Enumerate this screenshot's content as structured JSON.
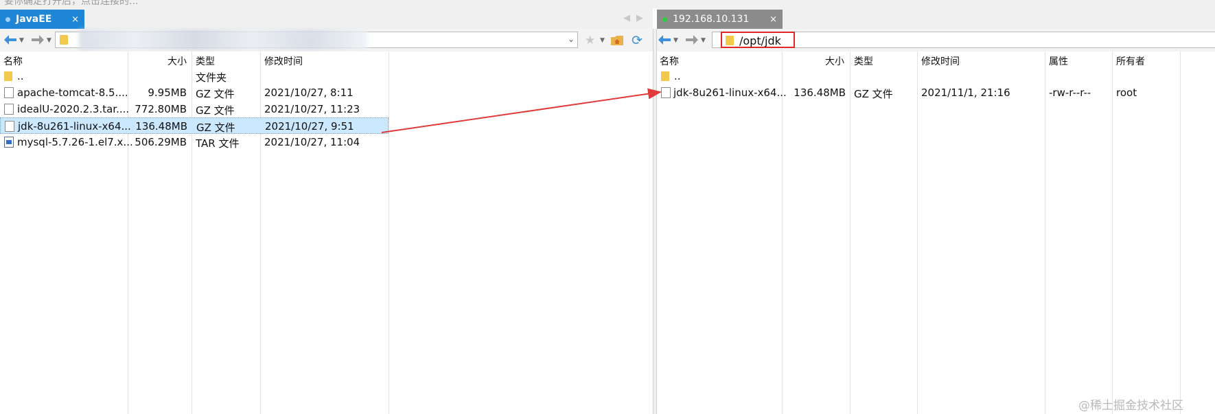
{
  "hint_text": "要你确定打开后，点击连接的...",
  "left_tab": {
    "label": "JavaEE",
    "close": "×",
    "dot_color": "#9fd0ff"
  },
  "right_tab": {
    "label": "192.168.10.131",
    "close": "×",
    "dot_color": "#2ecc40"
  },
  "tab_nav": {
    "prev": "◀",
    "next": "▶"
  },
  "left_path_value": "",
  "right_path_value": "/opt/jdk",
  "left_columns": [
    "名称",
    "大小",
    "类型",
    "修改时间"
  ],
  "right_columns": [
    "名称",
    "大小",
    "类型",
    "修改时间",
    "属性",
    "所有者"
  ],
  "left_files": [
    {
      "name": "..",
      "size": "",
      "type": "文件夹",
      "modified": "",
      "icon": "folder-icon"
    },
    {
      "name": "apache-tomcat-8.5....",
      "size": "9.95MB",
      "type": "GZ 文件",
      "modified": "2021/10/27, 8:11",
      "icon": "file-icon"
    },
    {
      "name": "idealU-2020.2.3.tar....",
      "size": "772.80MB",
      "type": "GZ 文件",
      "modified": "2021/10/27, 11:23",
      "icon": "file-icon"
    },
    {
      "name": "jdk-8u261-linux-x64...",
      "size": "136.48MB",
      "type": "GZ 文件",
      "modified": "2021/10/27, 9:51",
      "icon": "file-icon",
      "selected": true
    },
    {
      "name": "mysql-5.7.26-1.el7.x...",
      "size": "506.29MB",
      "type": "TAR 文件",
      "modified": "2021/10/27, 11:04",
      "icon": "tar-file-icon"
    }
  ],
  "right_files": [
    {
      "name": "..",
      "size": "",
      "type": "",
      "modified": "",
      "attr": "",
      "owner": "",
      "icon": "folder-icon"
    },
    {
      "name": "jdk-8u261-linux-x64...",
      "size": "136.48MB",
      "type": "GZ 文件",
      "modified": "2021/11/1, 21:16",
      "attr": "-rw-r--r--",
      "owner": "root",
      "icon": "file-icon"
    }
  ],
  "watermark": "@稀土掘金技术社区",
  "colors": {
    "accent_tab": "#1f86d6",
    "highlight_box": "#e02626",
    "arrow": "#e03a3a",
    "selection": "#cce8ff"
  }
}
